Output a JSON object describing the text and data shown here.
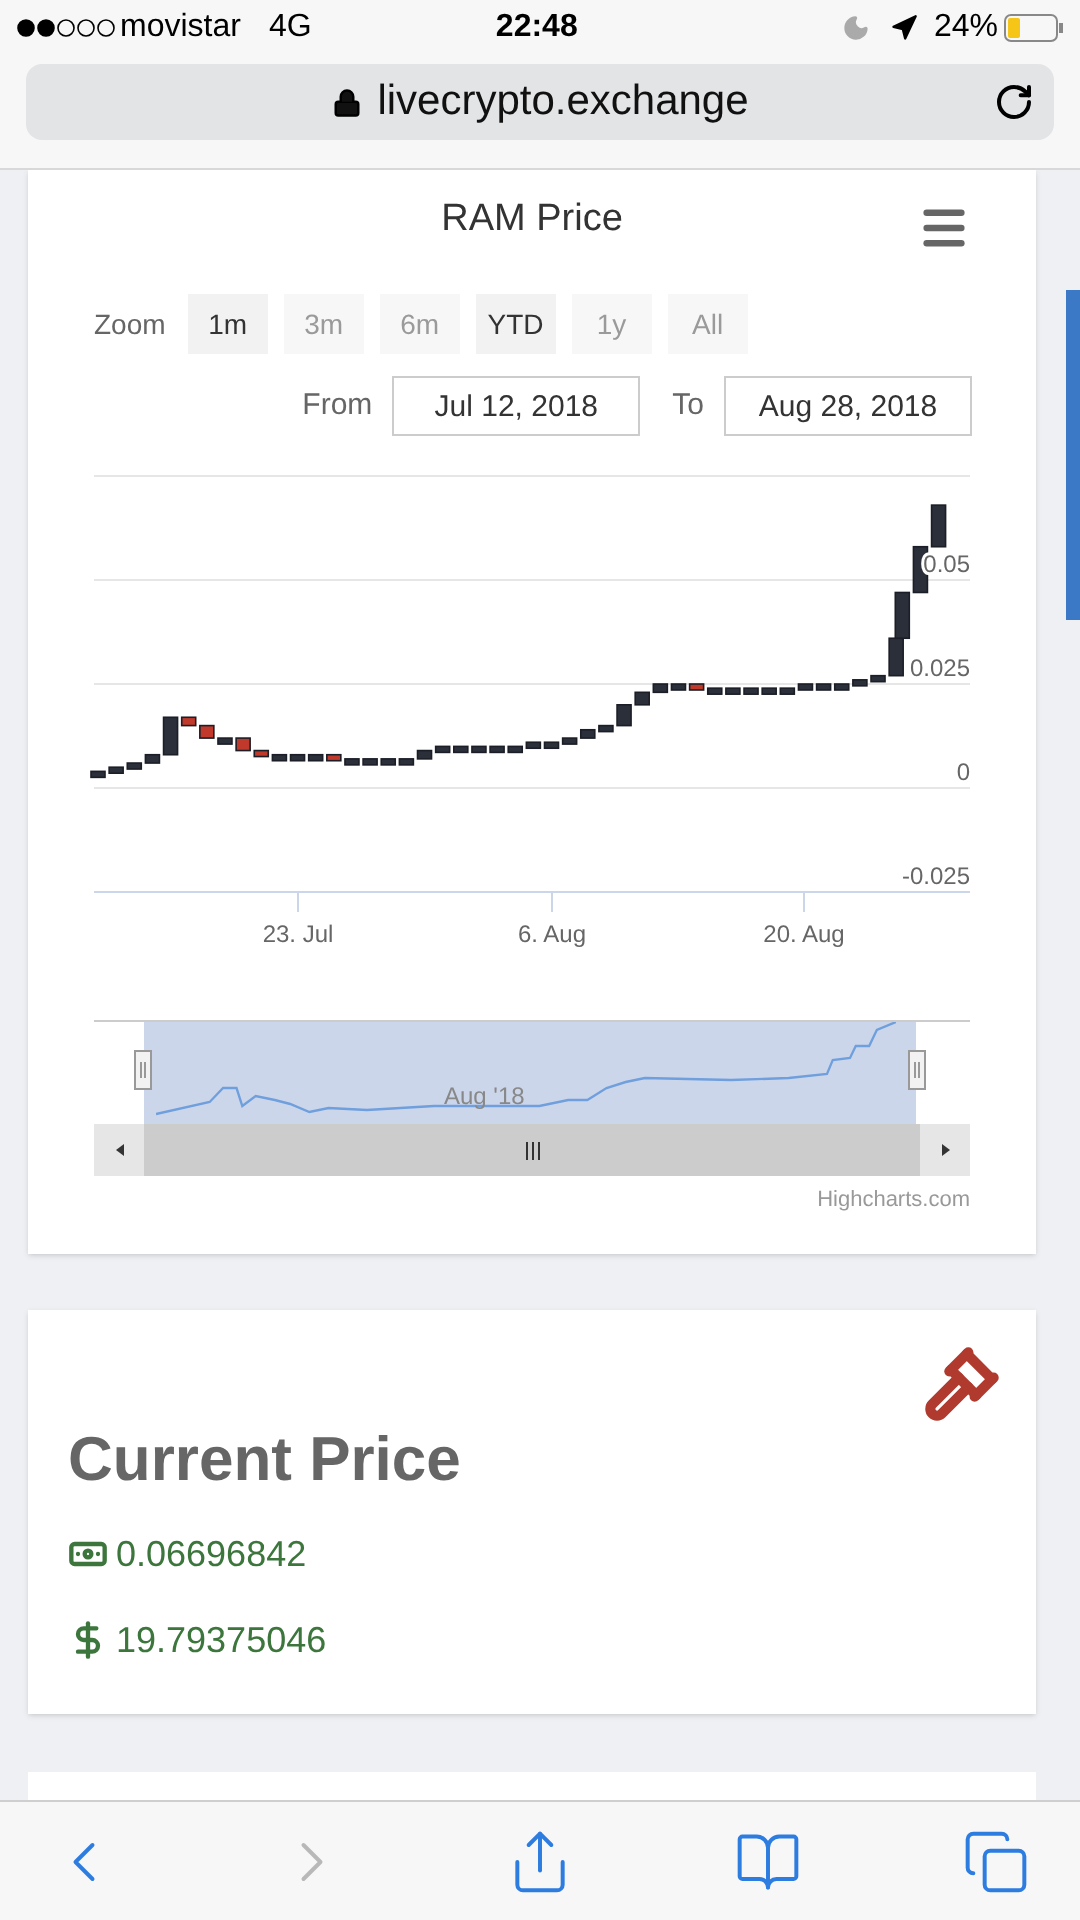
{
  "status_bar": {
    "carrier": "movistar",
    "network": "4G",
    "time": "22:48",
    "battery": "24%"
  },
  "address_bar": {
    "url": "livecrypto.exchange"
  },
  "chart_card": {
    "title": "RAM Price",
    "zoom_label": "Zoom",
    "zoom_buttons": [
      {
        "label": "1m",
        "disabled": false
      },
      {
        "label": "3m",
        "disabled": true
      },
      {
        "label": "6m",
        "disabled": true
      },
      {
        "label": "YTD",
        "disabled": false
      },
      {
        "label": "1y",
        "disabled": true
      },
      {
        "label": "All",
        "disabled": true
      }
    ],
    "from_label": "From",
    "from_value": "Jul 12, 2018",
    "to_label": "To",
    "to_value": "Aug 28, 2018",
    "y_axis_labels": [
      "0.05",
      "0.025",
      "0",
      "-0.025"
    ],
    "x_axis_labels": [
      "23. Jul",
      "6. Aug",
      "20. Aug"
    ],
    "navigator": {
      "label": "Aug '18"
    },
    "credit": "Highcharts.com"
  },
  "price_card": {
    "title": "Current Price",
    "prices": [
      {
        "kind": "bill",
        "value": "0.06696842"
      },
      {
        "kind": "dollar",
        "value": "19.79375046"
      }
    ]
  },
  "toolbar": [
    {
      "kind": "back",
      "disabled": false
    },
    {
      "kind": "forward",
      "disabled": true
    },
    {
      "kind": "share",
      "disabled": false
    },
    {
      "kind": "bookmarks",
      "disabled": false
    },
    {
      "kind": "tabs",
      "disabled": false
    }
  ]
}
